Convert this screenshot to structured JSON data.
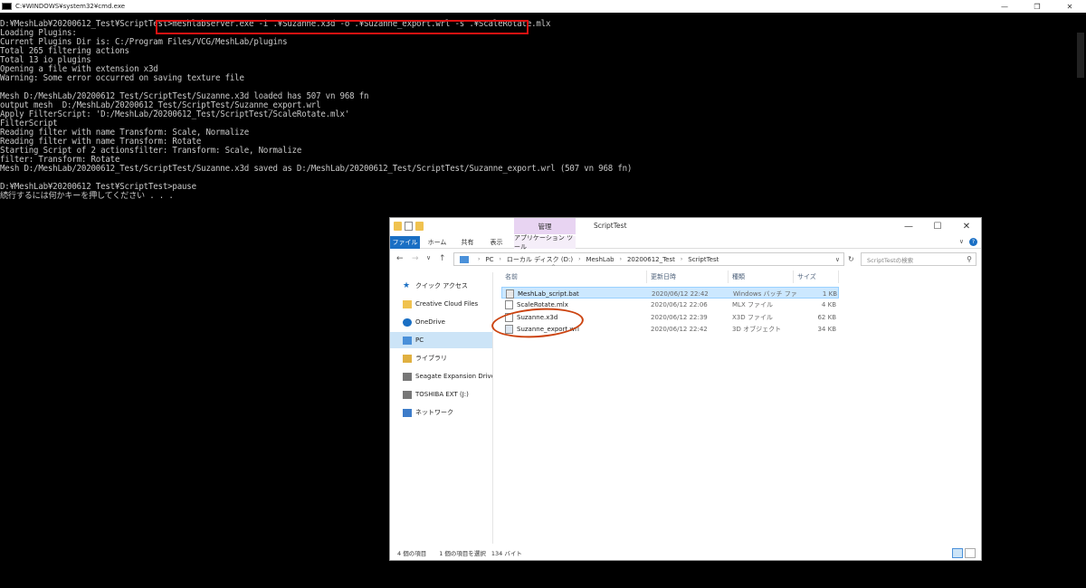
{
  "cmd": {
    "title": "C:¥WINDOWS¥system32¥cmd.exe",
    "controls": [
      "—",
      "❐",
      "✕"
    ],
    "lines": [
      "D:¥MeshLab¥20200612_Test¥ScriptTest>meshlabserver.exe -i .¥Suzanne.x3d -o .¥Suzanne_export.wrl -s .¥ScaleRotate.mlx",
      "Loading Plugins:",
      "Current Plugins Dir is: C:/Program Files/VCG/MeshLab/plugins",
      "Total 265 filtering actions",
      "Total 13 io plugins",
      "Opening a file with extension x3d",
      "Warning: Some error occurred on saving texture file",
      "",
      "Mesh D:/MeshLab/20200612_Test/ScriptTest/Suzanne.x3d loaded has 507 vn 968 fn",
      "output mesh  D:/MeshLab/20200612_Test/ScriptTest/Suzanne_export.wrl",
      "Apply FilterScript: 'D:/MeshLab/20200612_Test/ScriptTest/ScaleRotate.mlx'",
      "FilterScript",
      "Reading filter with name Transform: Scale, Normalize",
      "Reading filter with name Transform: Rotate",
      "Starting Script of 2 actionsfilter: Transform: Scale, Normalize",
      "filter: Transform: Rotate",
      "Mesh D:/MeshLab/20200612_Test/ScriptTest/Suzanne.x3d saved as D:/MeshLab/20200612_Test/ScriptTest/Suzanne_export.wrl (507 vn 968 fn)",
      "",
      "D:¥MeshLab¥20200612_Test¥ScriptTest>pause",
      "続行するには何かキーを押してください . . ."
    ]
  },
  "explorer": {
    "context_tab_header": "管理",
    "window_title": "ScriptTest",
    "controls": [
      "—",
      "☐",
      "✕"
    ],
    "ribbon_tabs": {
      "file": "ファイル",
      "home": "ホーム",
      "share": "共有",
      "view": "表示",
      "app_tools": "アプリケーション ツール"
    },
    "ribbon_right": {
      "expand": "∨",
      "help": "?"
    },
    "nav_buttons": {
      "back": "←",
      "forward": "→",
      "recent": "∨",
      "up": "↑"
    },
    "breadcrumb": [
      "PC",
      "ローカル ディスク (D:)",
      "MeshLab",
      "20200612_Test",
      "ScriptTest"
    ],
    "address_dropdown": "∨",
    "refresh": "↻",
    "search_placeholder": "ScriptTestの検索",
    "search_icon": "⚲",
    "sidebar": [
      {
        "label": "クイック アクセス",
        "icon": "star"
      },
      {
        "label": "Creative Cloud Files",
        "icon": "fold"
      },
      {
        "label": "OneDrive",
        "icon": "cloud"
      },
      {
        "label": "PC",
        "icon": "pc",
        "selected": true
      },
      {
        "label": "ライブラリ",
        "icon": "lib"
      },
      {
        "label": "Seagate Expansion Drive (",
        "icon": "drive"
      },
      {
        "label": "TOSHIBA EXT (J:)",
        "icon": "drive"
      },
      {
        "label": "ネットワーク",
        "icon": "net"
      }
    ],
    "columns": {
      "name": "名前",
      "date": "更新日時",
      "type": "種類",
      "size": "サイズ"
    },
    "sort_arrow": "^",
    "files": [
      {
        "name": "MeshLab_script.bat",
        "date": "2020/06/12 22:42",
        "type": "Windows バッチ ファ...",
        "size": "1 KB",
        "icon": "bat",
        "selected": true
      },
      {
        "name": "ScaleRotate.mlx",
        "date": "2020/06/12 22:06",
        "type": "MLX ファイル",
        "size": "4 KB",
        "icon": "doc",
        "selected": false
      },
      {
        "name": "Suzanne.x3d",
        "date": "2020/06/12 22:39",
        "type": "X3D ファイル",
        "size": "62 KB",
        "icon": "doc",
        "selected": false
      },
      {
        "name": "Suzanne_export.wrl",
        "date": "2020/06/12 22:42",
        "type": "3D オブジェクト",
        "size": "34 KB",
        "icon": "wrl",
        "selected": false
      }
    ],
    "status": {
      "count": "4 個の項目",
      "selected": "1 個の項目を選択",
      "size": "134 バイト"
    }
  }
}
